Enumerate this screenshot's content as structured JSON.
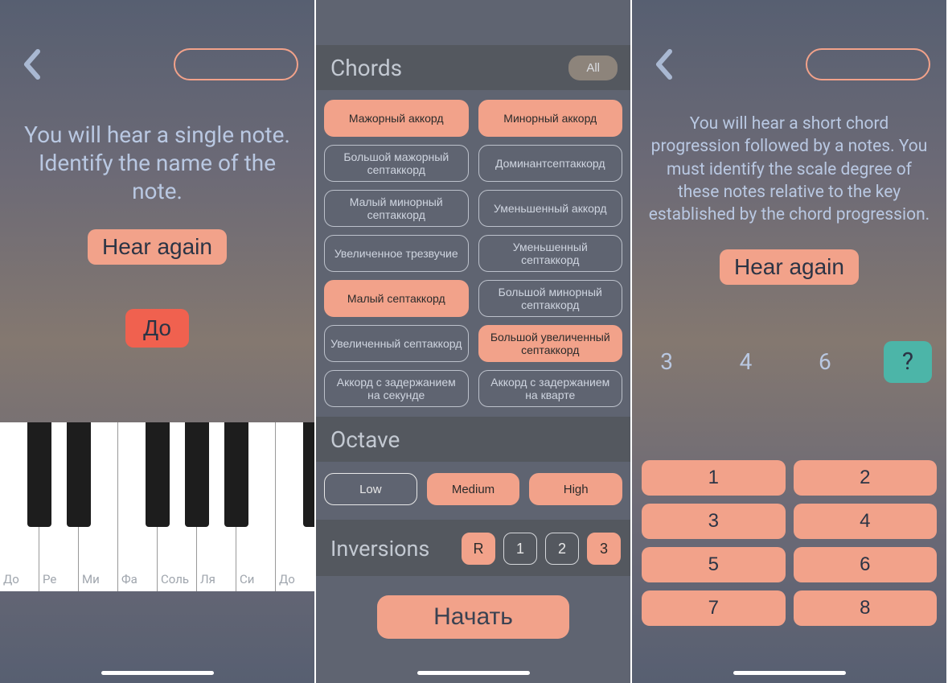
{
  "screen1": {
    "instructions": "You will hear a single note. Identify the name of the note.",
    "hear_label": "Hear again",
    "note_label": "До",
    "white_notes": [
      "До",
      "Ре",
      "Ми",
      "Фа",
      "Соль",
      "Ля",
      "Си",
      "До"
    ]
  },
  "screen2": {
    "chords_title": "Chords",
    "all_label": "All",
    "chords": [
      {
        "label": "Мажорный аккорд",
        "sel": true
      },
      {
        "label": "Минорный аккорд",
        "sel": true
      },
      {
        "label": "Большой мажорный септаккорд",
        "sel": false
      },
      {
        "label": "Доминантсептаккорд",
        "sel": false
      },
      {
        "label": "Малый минорный септаккорд",
        "sel": false
      },
      {
        "label": "Уменьшенный аккорд",
        "sel": false
      },
      {
        "label": "Увеличенное трезвучие",
        "sel": false
      },
      {
        "label": "Уменьшенный септаккорд",
        "sel": false
      },
      {
        "label": "Малый септаккорд",
        "sel": true
      },
      {
        "label": "Большой минорный септаккорд",
        "sel": false
      },
      {
        "label": "Увеличенный септаккорд",
        "sel": false
      },
      {
        "label": "Большой увеличенный септаккорд",
        "sel": true
      },
      {
        "label": "Аккорд с задержанием на секунде",
        "sel": false
      },
      {
        "label": "Аккорд с задержанием на кварте",
        "sel": false
      }
    ],
    "octave_title": "Octave",
    "octaves": [
      {
        "label": "Low",
        "sel": false
      },
      {
        "label": "Medium",
        "sel": true
      },
      {
        "label": "High",
        "sel": true
      }
    ],
    "inversions_title": "Inversions",
    "inversions": [
      {
        "label": "R",
        "sel": true
      },
      {
        "label": "1",
        "sel": false
      },
      {
        "label": "2",
        "sel": false
      },
      {
        "label": "3",
        "sel": true
      }
    ],
    "start_label": "Начать"
  },
  "screen3": {
    "instructions": "You will hear a short chord progression followed by a notes. You must identify the scale degree of these notes relative to the key established by the chord progression.",
    "hear_label": "Hear again",
    "slots": [
      "3",
      "4",
      "6",
      "?"
    ],
    "degrees": [
      "1",
      "2",
      "3",
      "4",
      "5",
      "6",
      "7",
      "8"
    ]
  }
}
